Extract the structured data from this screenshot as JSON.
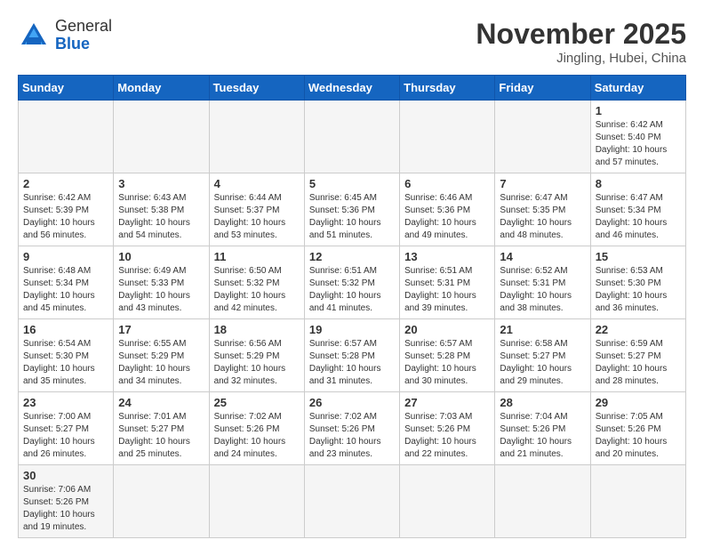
{
  "header": {
    "logo_general": "General",
    "logo_blue": "Blue",
    "month_title": "November 2025",
    "location": "Jingling, Hubei, China"
  },
  "weekdays": [
    "Sunday",
    "Monday",
    "Tuesday",
    "Wednesday",
    "Thursday",
    "Friday",
    "Saturday"
  ],
  "weeks": [
    [
      {
        "day": "",
        "info": ""
      },
      {
        "day": "",
        "info": ""
      },
      {
        "day": "",
        "info": ""
      },
      {
        "day": "",
        "info": ""
      },
      {
        "day": "",
        "info": ""
      },
      {
        "day": "",
        "info": ""
      },
      {
        "day": "1",
        "info": "Sunrise: 6:42 AM\nSunset: 5:40 PM\nDaylight: 10 hours and 57 minutes."
      }
    ],
    [
      {
        "day": "2",
        "info": "Sunrise: 6:42 AM\nSunset: 5:39 PM\nDaylight: 10 hours and 56 minutes."
      },
      {
        "day": "3",
        "info": "Sunrise: 6:43 AM\nSunset: 5:38 PM\nDaylight: 10 hours and 54 minutes."
      },
      {
        "day": "4",
        "info": "Sunrise: 6:44 AM\nSunset: 5:37 PM\nDaylight: 10 hours and 53 minutes."
      },
      {
        "day": "5",
        "info": "Sunrise: 6:45 AM\nSunset: 5:36 PM\nDaylight: 10 hours and 51 minutes."
      },
      {
        "day": "6",
        "info": "Sunrise: 6:46 AM\nSunset: 5:36 PM\nDaylight: 10 hours and 49 minutes."
      },
      {
        "day": "7",
        "info": "Sunrise: 6:47 AM\nSunset: 5:35 PM\nDaylight: 10 hours and 48 minutes."
      },
      {
        "day": "8",
        "info": "Sunrise: 6:47 AM\nSunset: 5:34 PM\nDaylight: 10 hours and 46 minutes."
      }
    ],
    [
      {
        "day": "9",
        "info": "Sunrise: 6:48 AM\nSunset: 5:34 PM\nDaylight: 10 hours and 45 minutes."
      },
      {
        "day": "10",
        "info": "Sunrise: 6:49 AM\nSunset: 5:33 PM\nDaylight: 10 hours and 43 minutes."
      },
      {
        "day": "11",
        "info": "Sunrise: 6:50 AM\nSunset: 5:32 PM\nDaylight: 10 hours and 42 minutes."
      },
      {
        "day": "12",
        "info": "Sunrise: 6:51 AM\nSunset: 5:32 PM\nDaylight: 10 hours and 41 minutes."
      },
      {
        "day": "13",
        "info": "Sunrise: 6:51 AM\nSunset: 5:31 PM\nDaylight: 10 hours and 39 minutes."
      },
      {
        "day": "14",
        "info": "Sunrise: 6:52 AM\nSunset: 5:31 PM\nDaylight: 10 hours and 38 minutes."
      },
      {
        "day": "15",
        "info": "Sunrise: 6:53 AM\nSunset: 5:30 PM\nDaylight: 10 hours and 36 minutes."
      }
    ],
    [
      {
        "day": "16",
        "info": "Sunrise: 6:54 AM\nSunset: 5:30 PM\nDaylight: 10 hours and 35 minutes."
      },
      {
        "day": "17",
        "info": "Sunrise: 6:55 AM\nSunset: 5:29 PM\nDaylight: 10 hours and 34 minutes."
      },
      {
        "day": "18",
        "info": "Sunrise: 6:56 AM\nSunset: 5:29 PM\nDaylight: 10 hours and 32 minutes."
      },
      {
        "day": "19",
        "info": "Sunrise: 6:57 AM\nSunset: 5:28 PM\nDaylight: 10 hours and 31 minutes."
      },
      {
        "day": "20",
        "info": "Sunrise: 6:57 AM\nSunset: 5:28 PM\nDaylight: 10 hours and 30 minutes."
      },
      {
        "day": "21",
        "info": "Sunrise: 6:58 AM\nSunset: 5:27 PM\nDaylight: 10 hours and 29 minutes."
      },
      {
        "day": "22",
        "info": "Sunrise: 6:59 AM\nSunset: 5:27 PM\nDaylight: 10 hours and 28 minutes."
      }
    ],
    [
      {
        "day": "23",
        "info": "Sunrise: 7:00 AM\nSunset: 5:27 PM\nDaylight: 10 hours and 26 minutes."
      },
      {
        "day": "24",
        "info": "Sunrise: 7:01 AM\nSunset: 5:27 PM\nDaylight: 10 hours and 25 minutes."
      },
      {
        "day": "25",
        "info": "Sunrise: 7:02 AM\nSunset: 5:26 PM\nDaylight: 10 hours and 24 minutes."
      },
      {
        "day": "26",
        "info": "Sunrise: 7:02 AM\nSunset: 5:26 PM\nDaylight: 10 hours and 23 minutes."
      },
      {
        "day": "27",
        "info": "Sunrise: 7:03 AM\nSunset: 5:26 PM\nDaylight: 10 hours and 22 minutes."
      },
      {
        "day": "28",
        "info": "Sunrise: 7:04 AM\nSunset: 5:26 PM\nDaylight: 10 hours and 21 minutes."
      },
      {
        "day": "29",
        "info": "Sunrise: 7:05 AM\nSunset: 5:26 PM\nDaylight: 10 hours and 20 minutes."
      }
    ],
    [
      {
        "day": "30",
        "info": "Sunrise: 7:06 AM\nSunset: 5:26 PM\nDaylight: 10 hours and 19 minutes."
      },
      {
        "day": "",
        "info": ""
      },
      {
        "day": "",
        "info": ""
      },
      {
        "day": "",
        "info": ""
      },
      {
        "day": "",
        "info": ""
      },
      {
        "day": "",
        "info": ""
      },
      {
        "day": "",
        "info": ""
      }
    ]
  ]
}
